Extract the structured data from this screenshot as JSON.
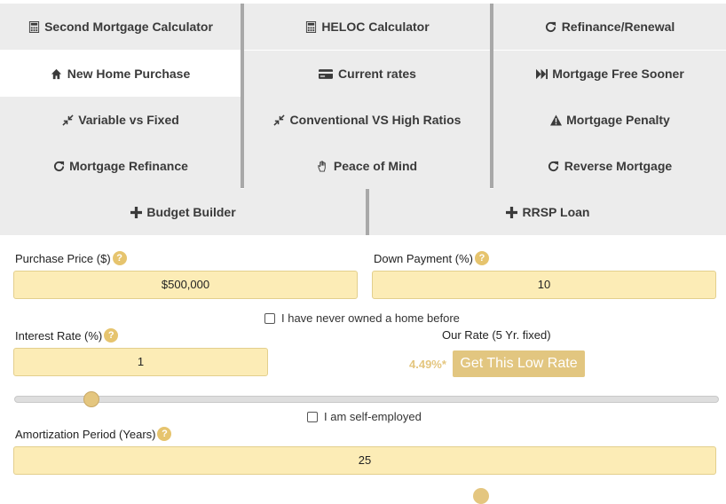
{
  "tabs": [
    {
      "label": "Second Mortgage Calculator",
      "icon": "calculator-icon",
      "active": false
    },
    {
      "label": "HELOC Calculator",
      "icon": "calculator-icon",
      "active": false
    },
    {
      "label": "Refinance/Renewal",
      "icon": "refresh-icon",
      "active": false
    },
    {
      "label": "New Home Purchase",
      "icon": "home-icon",
      "active": true
    },
    {
      "label": "Current rates",
      "icon": "credit-card-icon",
      "active": false
    },
    {
      "label": "Mortgage Free Sooner",
      "icon": "fast-forward-icon",
      "active": false
    },
    {
      "label": "Variable vs Fixed",
      "icon": "compress-icon",
      "active": false
    },
    {
      "label": "Conventional VS High Ratios",
      "icon": "compress-icon",
      "active": false
    },
    {
      "label": "Mortgage Penalty",
      "icon": "warning-icon",
      "active": false
    },
    {
      "label": "Mortgage Refinance",
      "icon": "refresh-icon",
      "active": false
    },
    {
      "label": "Peace of Mind",
      "icon": "hand-icon",
      "active": false
    },
    {
      "label": "Reverse Mortgage",
      "icon": "refresh-icon",
      "active": false
    },
    {
      "label": "Budget Builder",
      "icon": "plus-icon",
      "active": false
    },
    {
      "label": "RRSP Loan",
      "icon": "plus-icon",
      "active": false
    }
  ],
  "form": {
    "purchase_price_label": "Purchase Price ($)",
    "purchase_price_value": "$500,000",
    "down_payment_label": "Down Payment (%)",
    "down_payment_value": "10",
    "first_home_label": "I have never owned a home before",
    "first_home_checked": false,
    "interest_rate_label": "Interest Rate (%)",
    "interest_rate_value": "1",
    "our_rate_label": "Our Rate (5 Yr. fixed)",
    "our_rate_value": "4.49%*",
    "cta_label": "Get This Low Rate",
    "interest_slider_fraction": 0.11,
    "self_employed_label": "I am self-employed",
    "self_employed_checked": false,
    "amortization_label": "Amortization Period (Years)",
    "amortization_value": "25",
    "help_glyph": "?"
  },
  "colors": {
    "tab_bg": "#ececec",
    "tab_active_bg": "#ffffff",
    "field_bg": "#fcecb6",
    "accent": "#e2c680"
  }
}
